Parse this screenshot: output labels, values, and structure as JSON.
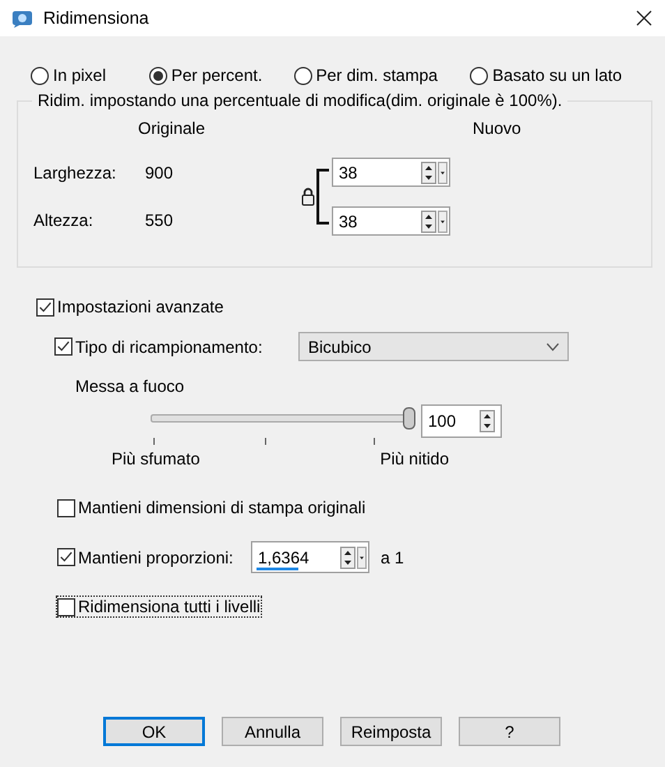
{
  "window": {
    "title": "Ridimensiona"
  },
  "modes": [
    {
      "label": "In pixel",
      "selected": false
    },
    {
      "label": "Per percent.",
      "selected": true
    },
    {
      "label": "Per dim. stampa",
      "selected": false
    },
    {
      "label": "Basato su un lato",
      "selected": false
    }
  ],
  "group": {
    "legend": "Ridim. impostando una percentuale di modifica(dim. originale è 100%).",
    "col_original": "Originale",
    "col_new": "Nuovo",
    "rows": [
      {
        "label": "Larghezza:",
        "original": "900",
        "value": "38"
      },
      {
        "label": "Altezza:",
        "original": "550",
        "value": "38"
      }
    ]
  },
  "advanced": {
    "label": "Impostazioni avanzate",
    "checked": true
  },
  "resample": {
    "label": "Tipo di ricampionamento:",
    "checked": true,
    "value": "Bicubico"
  },
  "sharpen": {
    "label": "Messa a fuoco",
    "level": 1,
    "min_label": "Più sfumato",
    "max_label": "Più nitido",
    "value": "100"
  },
  "options": [
    {
      "kind": "checkbox",
      "label": "Mantieni dimensioni di stampa originali",
      "checked": false,
      "focused": false
    },
    {
      "kind": "ratio",
      "label": "Mantieni proporzioni:",
      "checked": true,
      "value": "1,6364",
      "suffix": "a 1"
    },
    {
      "kind": "checkbox",
      "label": "Ridimensiona tutti i livelli",
      "checked": false,
      "focused": true
    }
  ],
  "buttons": [
    {
      "label": "OK",
      "default": true
    },
    {
      "label": "Annulla",
      "default": false
    },
    {
      "label": "Reimposta",
      "default": false
    },
    {
      "label": "?",
      "default": false
    }
  ]
}
